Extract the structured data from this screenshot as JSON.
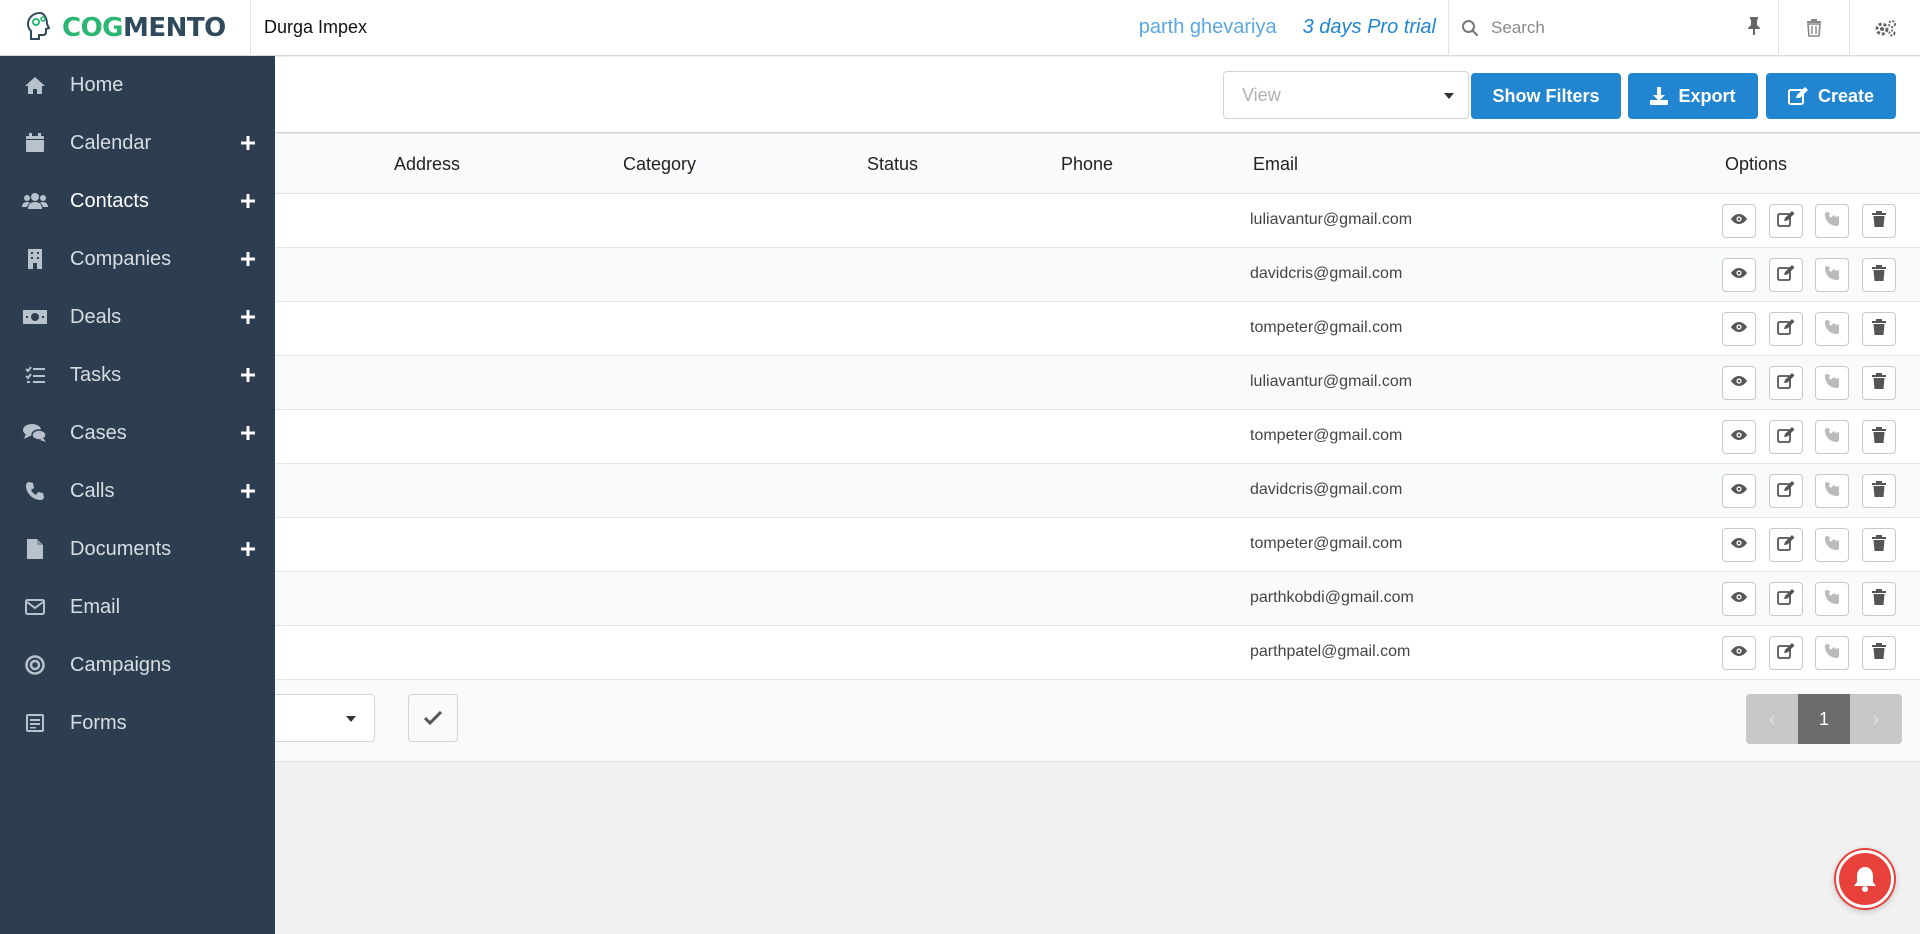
{
  "brand": {
    "logo_cog": "COG",
    "logo_mento": "MENTO"
  },
  "header": {
    "company": "Durga Impex",
    "user_name": "parth ghevariya",
    "trial": "3 days Pro trial",
    "search_placeholder": "Search"
  },
  "sidebar": {
    "items": [
      {
        "label": "Home",
        "icon": "home-icon",
        "has_add": false
      },
      {
        "label": "Calendar",
        "icon": "calendar-icon",
        "has_add": true
      },
      {
        "label": "Contacts",
        "icon": "users-icon",
        "has_add": true
      },
      {
        "label": "Companies",
        "icon": "building-icon",
        "has_add": true
      },
      {
        "label": "Deals",
        "icon": "money-icon",
        "has_add": true
      },
      {
        "label": "Tasks",
        "icon": "tasks-icon",
        "has_add": true
      },
      {
        "label": "Cases",
        "icon": "comments-icon",
        "has_add": true
      },
      {
        "label": "Calls",
        "icon": "phone-icon",
        "has_add": true
      },
      {
        "label": "Documents",
        "icon": "file-icon",
        "has_add": true
      },
      {
        "label": "Email",
        "icon": "envelope-icon",
        "has_add": false
      },
      {
        "label": "Campaigns",
        "icon": "bullseye-icon",
        "has_add": false
      },
      {
        "label": "Forms",
        "icon": "form-icon",
        "has_add": false
      }
    ],
    "active": "Contacts"
  },
  "toolbar": {
    "view_placeholder": "View",
    "show_filters_label": "Show Filters",
    "export_label": "Export",
    "create_label": "Create"
  },
  "table": {
    "columns": {
      "address": "Address",
      "category": "Category",
      "status": "Status",
      "phone": "Phone",
      "email": "Email",
      "options": "Options"
    },
    "rows": [
      {
        "email": "luliavantur@gmail.com"
      },
      {
        "email": "davidcris@gmail.com"
      },
      {
        "email": "tompeter@gmail.com"
      },
      {
        "email": "luliavantur@gmail.com"
      },
      {
        "email": "tompeter@gmail.com"
      },
      {
        "email": "davidcris@gmail.com"
      },
      {
        "email": "tompeter@gmail.com"
      },
      {
        "email": "parthkobdi@gmail.com"
      },
      {
        "email": "parthpatel@gmail.com"
      }
    ]
  },
  "pagination": {
    "current_page": "1"
  },
  "colors": {
    "sidebar_bg": "#2c3e50",
    "primary": "#2185d0",
    "brand_green": "#2bb673",
    "bell_red": "#e8413b"
  }
}
